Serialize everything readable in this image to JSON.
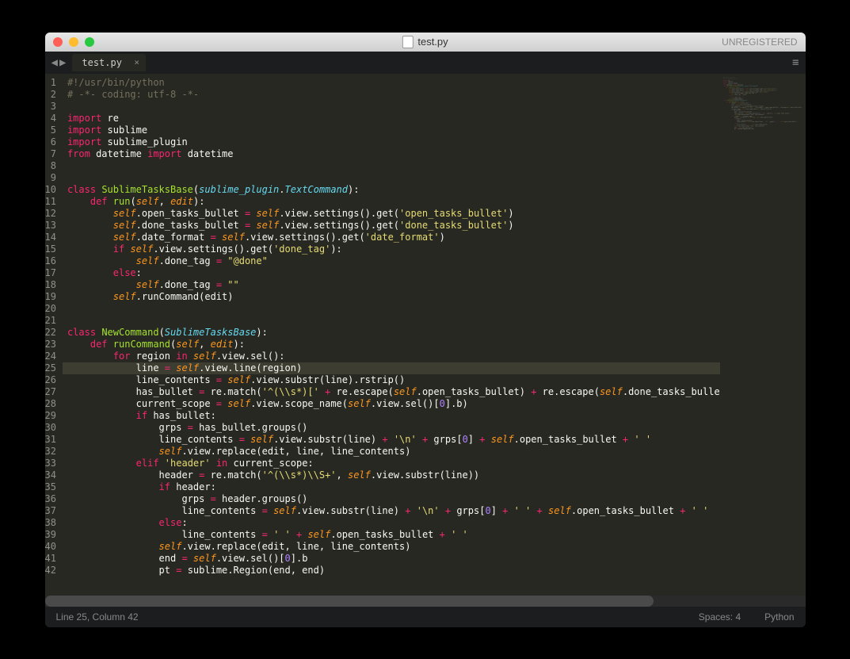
{
  "titlebar": {
    "title": "test.py",
    "unregistered": "UNREGISTERED"
  },
  "tab": {
    "name": "test.py"
  },
  "status": {
    "position": "Line 25, Column 42",
    "spaces": "Spaces: 4",
    "syntax": "Python"
  },
  "highlight_line": 25,
  "code": [
    [
      [
        "cm",
        "#!/usr/bin/python"
      ]
    ],
    [
      [
        "cm",
        "# -*- coding: utf-8 -*-"
      ]
    ],
    [],
    [
      [
        "kw",
        "import"
      ],
      [
        "pu",
        " re"
      ]
    ],
    [
      [
        "kw",
        "import"
      ],
      [
        "pu",
        " sublime"
      ]
    ],
    [
      [
        "kw",
        "import"
      ],
      [
        "pu",
        " sublime_plugin"
      ]
    ],
    [
      [
        "kw",
        "from"
      ],
      [
        "pu",
        " datetime "
      ],
      [
        "kw",
        "import"
      ],
      [
        "pu",
        " datetime"
      ]
    ],
    [],
    [],
    [
      [
        "kw",
        "class"
      ],
      [
        "pu",
        " "
      ],
      [
        "nm",
        "SublimeTasksBase"
      ],
      [
        "pu",
        "("
      ],
      [
        "bi",
        "sublime_plugin"
      ],
      [
        "pu",
        "."
      ],
      [
        "bi",
        "TextCommand"
      ],
      [
        "pu",
        "):"
      ]
    ],
    [
      [
        "pu",
        "    "
      ],
      [
        "kw",
        "def"
      ],
      [
        "pu",
        " "
      ],
      [
        "fn",
        "run"
      ],
      [
        "pu",
        "("
      ],
      [
        "pa",
        "self"
      ],
      [
        "pu",
        ", "
      ],
      [
        "pa",
        "edit"
      ],
      [
        "pu",
        "):"
      ]
    ],
    [
      [
        "pu",
        "        "
      ],
      [
        "pa",
        "self"
      ],
      [
        "pu",
        ".open_tasks_bullet "
      ],
      [
        "op",
        "="
      ],
      [
        "pu",
        " "
      ],
      [
        "pa",
        "self"
      ],
      [
        "pu",
        ".view.settings().get("
      ],
      [
        "str",
        "'open_tasks_bullet'"
      ],
      [
        "pu",
        ")"
      ]
    ],
    [
      [
        "pu",
        "        "
      ],
      [
        "pa",
        "self"
      ],
      [
        "pu",
        ".done_tasks_bullet "
      ],
      [
        "op",
        "="
      ],
      [
        "pu",
        " "
      ],
      [
        "pa",
        "self"
      ],
      [
        "pu",
        ".view.settings().get("
      ],
      [
        "str",
        "'done_tasks_bullet'"
      ],
      [
        "pu",
        ")"
      ]
    ],
    [
      [
        "pu",
        "        "
      ],
      [
        "pa",
        "self"
      ],
      [
        "pu",
        ".date_format "
      ],
      [
        "op",
        "="
      ],
      [
        "pu",
        " "
      ],
      [
        "pa",
        "self"
      ],
      [
        "pu",
        ".view.settings().get("
      ],
      [
        "str",
        "'date_format'"
      ],
      [
        "pu",
        ")"
      ]
    ],
    [
      [
        "pu",
        "        "
      ],
      [
        "kw",
        "if"
      ],
      [
        "pu",
        " "
      ],
      [
        "pa",
        "self"
      ],
      [
        "pu",
        ".view.settings().get("
      ],
      [
        "str",
        "'done_tag'"
      ],
      [
        "pu",
        "):"
      ]
    ],
    [
      [
        "pu",
        "            "
      ],
      [
        "pa",
        "self"
      ],
      [
        "pu",
        ".done_tag "
      ],
      [
        "op",
        "="
      ],
      [
        "pu",
        " "
      ],
      [
        "str",
        "\"@done\""
      ]
    ],
    [
      [
        "pu",
        "        "
      ],
      [
        "kw",
        "else"
      ],
      [
        "pu",
        ":"
      ]
    ],
    [
      [
        "pu",
        "            "
      ],
      [
        "pa",
        "self"
      ],
      [
        "pu",
        ".done_tag "
      ],
      [
        "op",
        "="
      ],
      [
        "pu",
        " "
      ],
      [
        "str",
        "\"\""
      ]
    ],
    [
      [
        "pu",
        "        "
      ],
      [
        "pa",
        "self"
      ],
      [
        "pu",
        ".runCommand(edit)"
      ]
    ],
    [],
    [],
    [
      [
        "kw",
        "class"
      ],
      [
        "pu",
        " "
      ],
      [
        "nm",
        "NewCommand"
      ],
      [
        "pu",
        "("
      ],
      [
        "bi",
        "SublimeTasksBase"
      ],
      [
        "pu",
        "):"
      ]
    ],
    [
      [
        "pu",
        "    "
      ],
      [
        "kw",
        "def"
      ],
      [
        "pu",
        " "
      ],
      [
        "fn",
        "runCommand"
      ],
      [
        "pu",
        "("
      ],
      [
        "pa",
        "self"
      ],
      [
        "pu",
        ", "
      ],
      [
        "pa",
        "edit"
      ],
      [
        "pu",
        "):"
      ]
    ],
    [
      [
        "pu",
        "        "
      ],
      [
        "kw",
        "for"
      ],
      [
        "pu",
        " region "
      ],
      [
        "kw",
        "in"
      ],
      [
        "pu",
        " "
      ],
      [
        "pa",
        "self"
      ],
      [
        "pu",
        ".view.sel():"
      ]
    ],
    [
      [
        "pu",
        "            line "
      ],
      [
        "op",
        "="
      ],
      [
        "pu",
        " "
      ],
      [
        "pa",
        "self"
      ],
      [
        "pu",
        ".view.line(region)"
      ]
    ],
    [
      [
        "pu",
        "            line_contents "
      ],
      [
        "op",
        "="
      ],
      [
        "pu",
        " "
      ],
      [
        "pa",
        "self"
      ],
      [
        "pu",
        ".view.substr(line).rstrip()"
      ]
    ],
    [
      [
        "pu",
        "            has_bullet "
      ],
      [
        "op",
        "="
      ],
      [
        "pu",
        " re.match("
      ],
      [
        "str",
        "'^(\\\\s*)['"
      ],
      [
        "pu",
        " "
      ],
      [
        "op",
        "+"
      ],
      [
        "pu",
        " re.escape("
      ],
      [
        "pa",
        "self"
      ],
      [
        "pu",
        ".open_tasks_bullet) "
      ],
      [
        "op",
        "+"
      ],
      [
        "pu",
        " re.escape("
      ],
      [
        "pa",
        "self"
      ],
      [
        "pu",
        ".done_tasks_bulle"
      ]
    ],
    [
      [
        "pu",
        "            current_scope "
      ],
      [
        "op",
        "="
      ],
      [
        "pu",
        " "
      ],
      [
        "pa",
        "self"
      ],
      [
        "pu",
        ".view.scope_name("
      ],
      [
        "pa",
        "self"
      ],
      [
        "pu",
        ".view.sel()["
      ],
      [
        "num",
        "0"
      ],
      [
        "pu",
        "].b)"
      ]
    ],
    [
      [
        "pu",
        "            "
      ],
      [
        "kw",
        "if"
      ],
      [
        "pu",
        " has_bullet:"
      ]
    ],
    [
      [
        "pu",
        "                grps "
      ],
      [
        "op",
        "="
      ],
      [
        "pu",
        " has_bullet.groups()"
      ]
    ],
    [
      [
        "pu",
        "                line_contents "
      ],
      [
        "op",
        "="
      ],
      [
        "pu",
        " "
      ],
      [
        "pa",
        "self"
      ],
      [
        "pu",
        ".view.substr(line) "
      ],
      [
        "op",
        "+"
      ],
      [
        "pu",
        " "
      ],
      [
        "str",
        "'\\n'"
      ],
      [
        "pu",
        " "
      ],
      [
        "op",
        "+"
      ],
      [
        "pu",
        " grps["
      ],
      [
        "num",
        "0"
      ],
      [
        "pu",
        "] "
      ],
      [
        "op",
        "+"
      ],
      [
        "pu",
        " "
      ],
      [
        "pa",
        "self"
      ],
      [
        "pu",
        ".open_tasks_bullet "
      ],
      [
        "op",
        "+"
      ],
      [
        "pu",
        " "
      ],
      [
        "str",
        "' '"
      ]
    ],
    [
      [
        "pu",
        "                "
      ],
      [
        "pa",
        "self"
      ],
      [
        "pu",
        ".view.replace(edit, line, line_contents)"
      ]
    ],
    [
      [
        "pu",
        "            "
      ],
      [
        "kw",
        "elif"
      ],
      [
        "pu",
        " "
      ],
      [
        "str",
        "'header'"
      ],
      [
        "pu",
        " "
      ],
      [
        "kw",
        "in"
      ],
      [
        "pu",
        " current_scope:"
      ]
    ],
    [
      [
        "pu",
        "                header "
      ],
      [
        "op",
        "="
      ],
      [
        "pu",
        " re.match("
      ],
      [
        "str",
        "'^(\\\\s*)\\\\S+'"
      ],
      [
        "pu",
        ", "
      ],
      [
        "pa",
        "self"
      ],
      [
        "pu",
        ".view.substr(line))"
      ]
    ],
    [
      [
        "pu",
        "                "
      ],
      [
        "kw",
        "if"
      ],
      [
        "pu",
        " header:"
      ]
    ],
    [
      [
        "pu",
        "                    grps "
      ],
      [
        "op",
        "="
      ],
      [
        "pu",
        " header.groups()"
      ]
    ],
    [
      [
        "pu",
        "                    line_contents "
      ],
      [
        "op",
        "="
      ],
      [
        "pu",
        " "
      ],
      [
        "pa",
        "self"
      ],
      [
        "pu",
        ".view.substr(line) "
      ],
      [
        "op",
        "+"
      ],
      [
        "pu",
        " "
      ],
      [
        "str",
        "'\\n'"
      ],
      [
        "pu",
        " "
      ],
      [
        "op",
        "+"
      ],
      [
        "pu",
        " grps["
      ],
      [
        "num",
        "0"
      ],
      [
        "pu",
        "] "
      ],
      [
        "op",
        "+"
      ],
      [
        "pu",
        " "
      ],
      [
        "str",
        "' '"
      ],
      [
        "pu",
        " "
      ],
      [
        "op",
        "+"
      ],
      [
        "pu",
        " "
      ],
      [
        "pa",
        "self"
      ],
      [
        "pu",
        ".open_tasks_bullet "
      ],
      [
        "op",
        "+"
      ],
      [
        "pu",
        " "
      ],
      [
        "str",
        "' '"
      ]
    ],
    [
      [
        "pu",
        "                "
      ],
      [
        "kw",
        "else"
      ],
      [
        "pu",
        ":"
      ]
    ],
    [
      [
        "pu",
        "                    line_contents "
      ],
      [
        "op",
        "="
      ],
      [
        "pu",
        " "
      ],
      [
        "str",
        "' '"
      ],
      [
        "pu",
        " "
      ],
      [
        "op",
        "+"
      ],
      [
        "pu",
        " "
      ],
      [
        "pa",
        "self"
      ],
      [
        "pu",
        ".open_tasks_bullet "
      ],
      [
        "op",
        "+"
      ],
      [
        "pu",
        " "
      ],
      [
        "str",
        "' '"
      ]
    ],
    [
      [
        "pu",
        "                "
      ],
      [
        "pa",
        "self"
      ],
      [
        "pu",
        ".view.replace(edit, line, line_contents)"
      ]
    ],
    [
      [
        "pu",
        "                end "
      ],
      [
        "op",
        "="
      ],
      [
        "pu",
        " "
      ],
      [
        "pa",
        "self"
      ],
      [
        "pu",
        ".view.sel()["
      ],
      [
        "num",
        "0"
      ],
      [
        "pu",
        "].b"
      ]
    ],
    [
      [
        "pu",
        "                pt "
      ],
      [
        "op",
        "="
      ],
      [
        "pu",
        " sublime.Region(end, end)"
      ]
    ]
  ]
}
